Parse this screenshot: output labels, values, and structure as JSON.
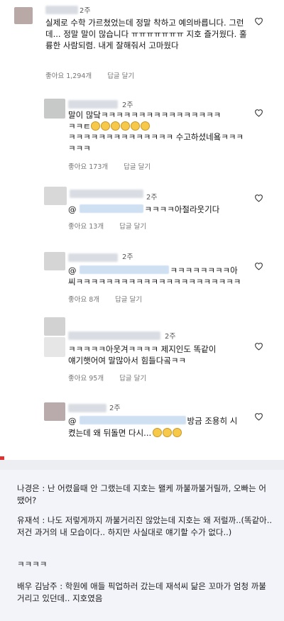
{
  "comments": [
    {
      "time": "2주",
      "text": "실제로 수학 가르쳤었는데 정말 착하고 예의바릅니다. 그런데... 정말 말이 많습니다 ㅠㅠㅠㅠㅠㅠㅠ 지호 즐거웠다. 훌륭한 사람되렴. 내게 잘해줘서 고마웠다",
      "likes": "좋아요 1,294개",
      "reply": "답글 달기"
    },
    {
      "time": "2주",
      "text_line1": "말이 많닼ㅋㅋㅋㅋㅋㅋㅋㅋㅋㅋㅋㅋㅋㅋㅋㅋ",
      "text_line2_prefix": "ㅋㅋㅌ",
      "text_line3": "ㅋㅋㅋㅋㅋㅋㅋㅋㅋㅋㅋㅋㅋㅋ 수고하셨네욬ㅋㅋㅋ",
      "text_line4": "ㅋㅋㅋ",
      "likes": "좋아요 173개",
      "reply": "답글 달기"
    },
    {
      "time": "2주",
      "mention_prefix": "@",
      "text": "ㅋㅋㅋㅋ아절라웃기다",
      "likes": "좋아요 13개",
      "reply": "답글 달기"
    },
    {
      "time": "2주",
      "mention_prefix": "@",
      "text_line1_suffix": "ㅋㅋㅋㅋㅋㅋㅋㅋ아",
      "text_line2": "씨ㅋㅋㅋㅋㅋㅋㅋㅋㅋㅋㅋㅋㅋㅋㅋㅋㅋㅋㅋㅋㅋㅋ",
      "likes": "좋아요 8개",
      "reply": "답글 달기"
    },
    {
      "time": "2주",
      "text": "ㅋㅋㅋㅋㅋ아웃겨ㅋㅋㅋㅋ 제지인도 똑같이\n얘기햇어여 말많아서 힘들다곸ㅋㅋ",
      "likes": "좋아요 95개",
      "reply": "답글 달기"
    },
    {
      "time": "2주",
      "mention_prefix": "@",
      "text_line1_suffix": "방금 조용히 시",
      "text_line2": "켰는데 왜 뒤돌면 다시..."
    }
  ],
  "article": {
    "p1": "나경은 : 난 어렸을때 안 그랬는데 지호는 왤케 까불까불거릴까, 오빠는 어땠어?",
    "p2": "유재석 : 나도 저렇게까지 까불거리진 않았는데 지호는 왜 저럴까..(똑같아.. 저건 과거의 내 모습이다.. 하지만 사실대로 얘기할 수가 없다..)",
    "p3": "ㅋㅋㅋㅋ",
    "p4": "배우 김남주 : 학원에 애들 픽업하러 갔는데 재석씨 닮은 꼬마가 엄청 까불거리고 있던데.. 지호였음"
  },
  "icons": {
    "heart": "heart-outline-icon",
    "emoji": "laughing-face-icon"
  },
  "colors": {
    "accent_bg": "#f3f4fa",
    "mention": "#cfe0f3"
  }
}
